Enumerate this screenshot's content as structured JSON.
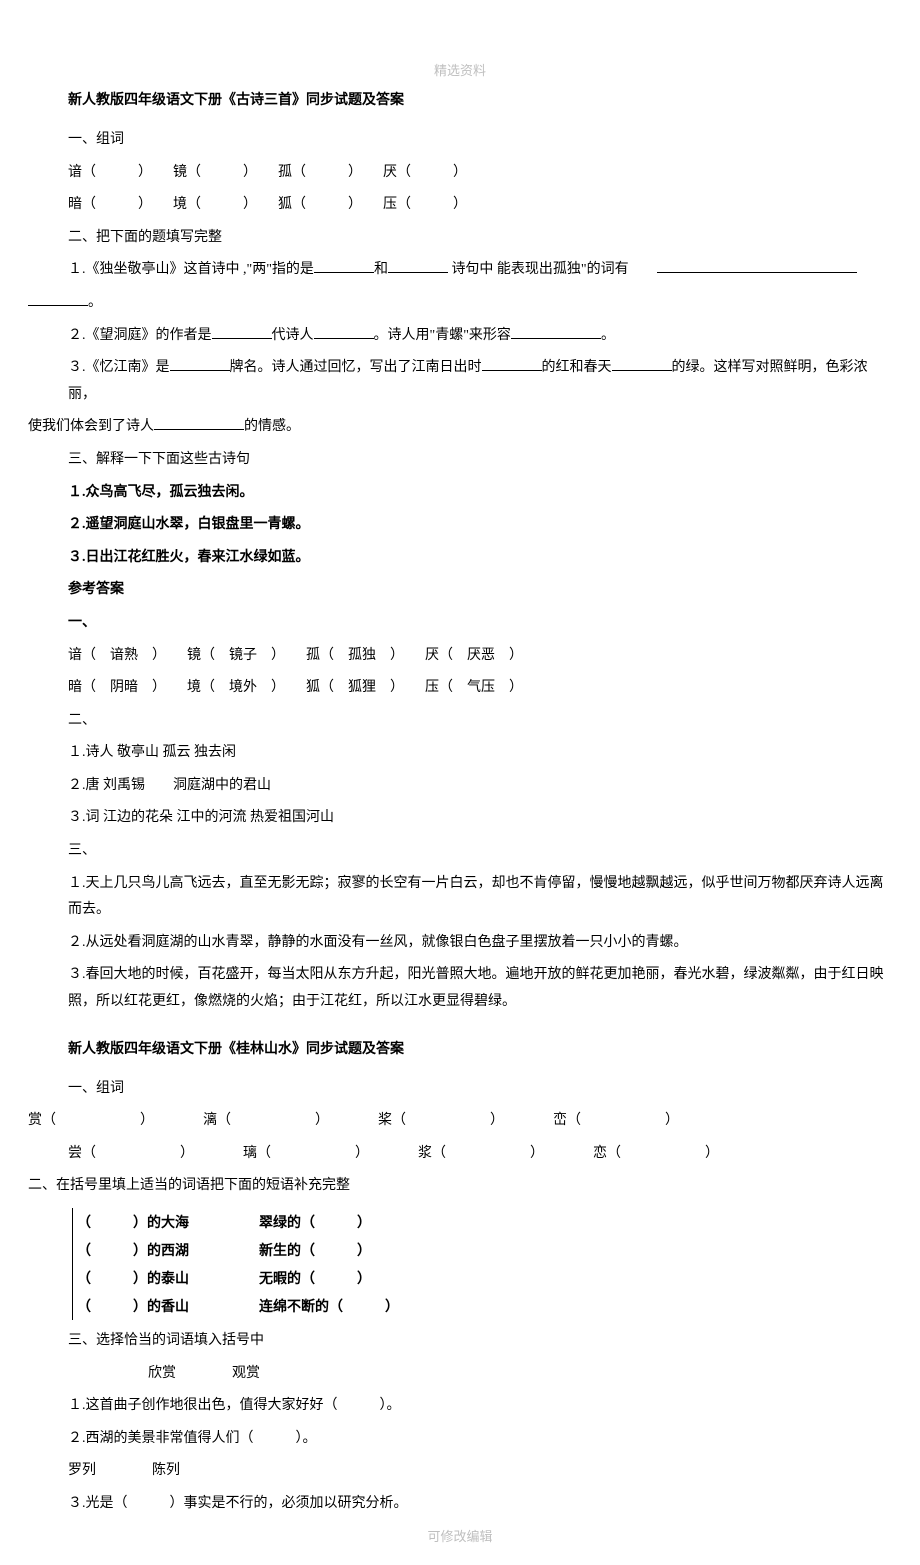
{
  "watermark_top": "精选资料",
  "watermark_bottom": "可修改编辑",
  "s1": {
    "title": "新人教版四年级语文下册《古诗三首》同步试题及答案",
    "q1_label": "一、组词",
    "q1_r1": "谙（　　　）　　镜（　　　）　　孤（　　　）　　厌（　　　）",
    "q1_r2": "暗（　　　）　　境（　　　）　　狐（　　　）　　压（　　　）",
    "q2_label": "二、把下面的题填写完整",
    "q2_1_a": "１.《独坐敬亭山》这首诗中 ,\"两\"指的是",
    "q2_1_b": "和",
    "q2_1_c": " 诗句中 能表现出孤独\"的词有",
    "q2_1_d": "。",
    "q2_2_a": "２.《望洞庭》的作者是",
    "q2_2_b": "代诗人",
    "q2_2_c": "。诗人用\"青螺\"来形容",
    "q2_2_d": "。",
    "q2_3_a": "３.《忆江南》是",
    "q2_3_b": "牌名。诗人通过回忆，写出了江南日出时",
    "q2_3_c": "的红和春天",
    "q2_3_d": "的绿。这样写对照鲜明，色彩浓丽，",
    "q2_3_e": "使我们体会到了诗人",
    "q2_3_f": "的情感。",
    "q3_label": "三、解释一下下面这些古诗句",
    "q3_1": "１.众鸟高飞尽，孤云独去闲。",
    "q3_2": "２.遥望洞庭山水翠，白银盘里一青螺。",
    "q3_3": "３.日出江花红胜火，春来江水绿如蓝。",
    "ans_label": "参考答案",
    "a1_label": "一、",
    "a1_r1": "谙（　谙熟　）　　镜（　镜子　）　　孤（　孤独　）　　厌（　厌恶　）",
    "a1_r2": "暗（　阴暗　）　　境（　境外　）　　狐（　狐狸　）　　压（　气压　）",
    "a2_label": "二、",
    "a2_1": "１.诗人  敬亭山  孤云  独去闲",
    "a2_2": "２.唐  刘禹锡　　洞庭湖中的君山",
    "a2_3": "３.词  江边的花朵  江中的河流  热爱祖国河山",
    "a3_label": "三、",
    "a3_1": "１.天上几只鸟儿高飞远去，直至无影无踪；寂寥的长空有一片白云，却也不肯停留，慢慢地越飘越远，似乎世间万物都厌弃诗人远离而去。",
    "a3_2": "２.从远处看洞庭湖的山水青翠，静静的水面没有一丝风，就像银白色盘子里摆放着一只小小的青螺。",
    "a3_3": "３.春回大地的时候，百花盛开，每当太阳从东方升起，阳光普照大地。遍地开放的鲜花更加艳丽，春光水碧，绿波粼粼，由于红日映照，所以红花更红，像燃烧的火焰；由于江花红，所以江水更显得碧绿。"
  },
  "s2": {
    "title": "新人教版四年级语文下册《桂林山水》同步试题及答案",
    "q1_label": "一、组词",
    "q1_r1": "赏（　　　　　　）　　　　漓（　　　　　　）　　　　桨（　　　　　　）　　　　峦（　　　　　　）",
    "q1_r2": "尝（　　　　　　）　　　　璃（　　　　　　）　　　　浆（　　　　　　）　　　　恋（　　　　　　）",
    "q2_label": "二、在括号里填上适当的词语把下面的短语补充完整",
    "t_r1": "（　　　）的大海　　　　　翠绿的（　　　）",
    "t_r2": "（　　　）的西湖　　　　　新生的（　　　）",
    "t_r3": "（　　　）的泰山　　　　　无暇的（　　　）",
    "t_r4": "（　　　）的香山　　　　　连绵不断的（　　　）",
    "q3_label": "三、选择恰当的词语填入括号中",
    "q3_opt1": "欣赏　　　　观赏",
    "q3_1": "１.这首曲子创作地很出色，值得大家好好（　　　）。",
    "q3_2": "２.西湖的美景非常值得人们（　　　）。",
    "q3_opt2": "罗列　　　　陈列",
    "q3_3": "３.光是（　　　）事实是不行的，必须加以研究分析。"
  }
}
